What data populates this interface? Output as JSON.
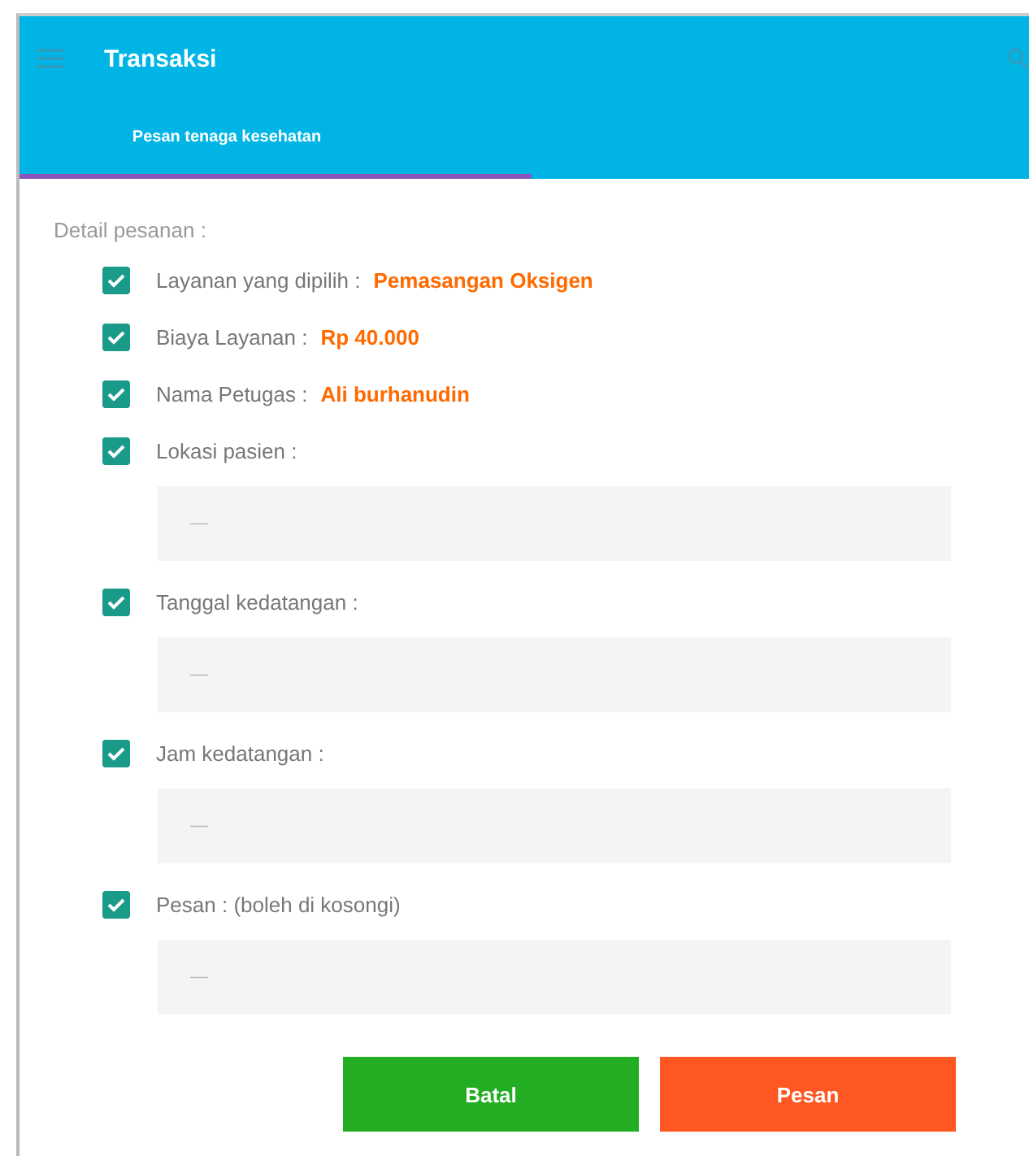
{
  "app_bar": {
    "title": "Transaksi"
  },
  "tabs": [
    {
      "label": "Pesan tenaga kesehatan",
      "selected": true
    }
  ],
  "section_title": "Detail pesanan :",
  "items": [
    {
      "kind": "info",
      "checked": true,
      "label": "Layanan yang dipilih :",
      "value": "Pemasangan Oksigen"
    },
    {
      "kind": "info",
      "checked": true,
      "label": "Biaya Layanan :",
      "value": "Rp 40.000"
    },
    {
      "kind": "info",
      "checked": true,
      "label": "Nama Petugas :",
      "value": "Ali burhanudin"
    },
    {
      "kind": "field",
      "checked": true,
      "label": "Lokasi pasien :",
      "placeholder": "—"
    },
    {
      "kind": "field",
      "checked": true,
      "label": "Tanggal kedatangan :",
      "placeholder": "—"
    },
    {
      "kind": "field",
      "checked": true,
      "label": "Jam kedatangan :",
      "placeholder": "—"
    },
    {
      "kind": "field",
      "checked": true,
      "label": "Pesan : (boleh di kosongi)",
      "placeholder": "—"
    }
  ],
  "buttons": [
    {
      "kind": "cancel",
      "label": "Batal"
    },
    {
      "kind": "submit",
      "label": "Pesan"
    }
  ]
}
